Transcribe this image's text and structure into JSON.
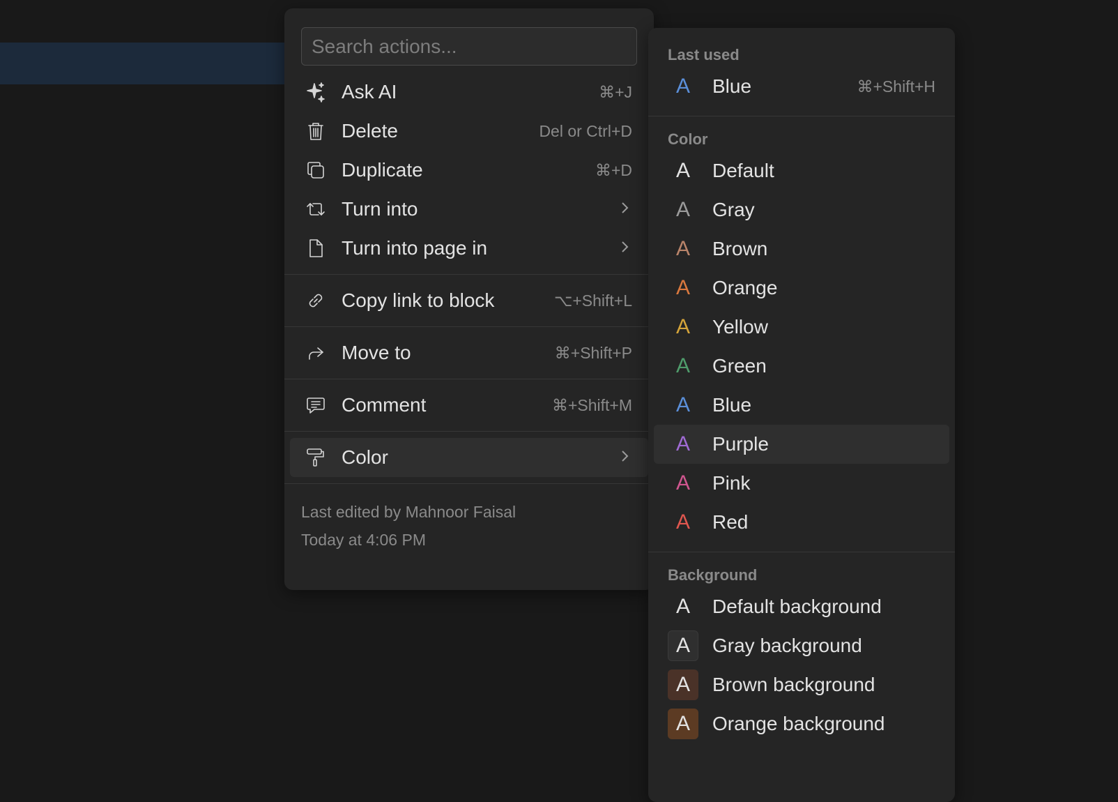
{
  "menu": {
    "search_placeholder": "Search actions...",
    "items": [
      {
        "label": "Ask AI",
        "shortcut": "⌘+J",
        "icon": "sparkle-icon"
      },
      {
        "label": "Delete",
        "shortcut": "Del or Ctrl+D",
        "icon": "trash-icon"
      },
      {
        "label": "Duplicate",
        "shortcut": "⌘+D",
        "icon": "duplicate-icon"
      },
      {
        "label": "Turn into",
        "icon": "turn-into-icon"
      },
      {
        "label": "Turn into page in",
        "icon": "page-icon"
      },
      {
        "label": "Copy link to block",
        "shortcut": "⌥+Shift+L",
        "icon": "link-icon"
      },
      {
        "label": "Move to",
        "shortcut": "⌘+Shift+P",
        "icon": "arrow-forward-icon"
      },
      {
        "label": "Comment",
        "shortcut": "⌘+Shift+M",
        "icon": "comment-icon"
      },
      {
        "label": "Color",
        "icon": "paint-roller-icon"
      }
    ],
    "footer": {
      "edited_by": "Last edited by Mahnoor Faisal",
      "edited_at": "Today at 4:06 PM"
    }
  },
  "submenu": {
    "last_used_title": "Last used",
    "last_used": {
      "label": "Blue",
      "shortcut": "⌘+Shift+H",
      "color": "#5b8fd9"
    },
    "color_title": "Color",
    "colors": [
      {
        "label": "Default",
        "color": "#e3e3e3"
      },
      {
        "label": "Gray",
        "color": "#9b9b9b"
      },
      {
        "label": "Brown",
        "color": "#b9846a"
      },
      {
        "label": "Orange",
        "color": "#d9783e"
      },
      {
        "label": "Yellow",
        "color": "#d4a43a"
      },
      {
        "label": "Green",
        "color": "#4f9c6b"
      },
      {
        "label": "Blue",
        "color": "#5b8fd9"
      },
      {
        "label": "Purple",
        "color": "#a06bd4"
      },
      {
        "label": "Pink",
        "color": "#d0568f"
      },
      {
        "label": "Red",
        "color": "#e0574f"
      }
    ],
    "background_title": "Background",
    "backgrounds": [
      {
        "label": "Default background",
        "bg": "transparent"
      },
      {
        "label": "Gray background",
        "bg": "#2f2f2f"
      },
      {
        "label": "Brown background",
        "bg": "#4a3228"
      },
      {
        "label": "Orange background",
        "bg": "#5c3b23"
      }
    ],
    "swatch_letter": "A"
  }
}
